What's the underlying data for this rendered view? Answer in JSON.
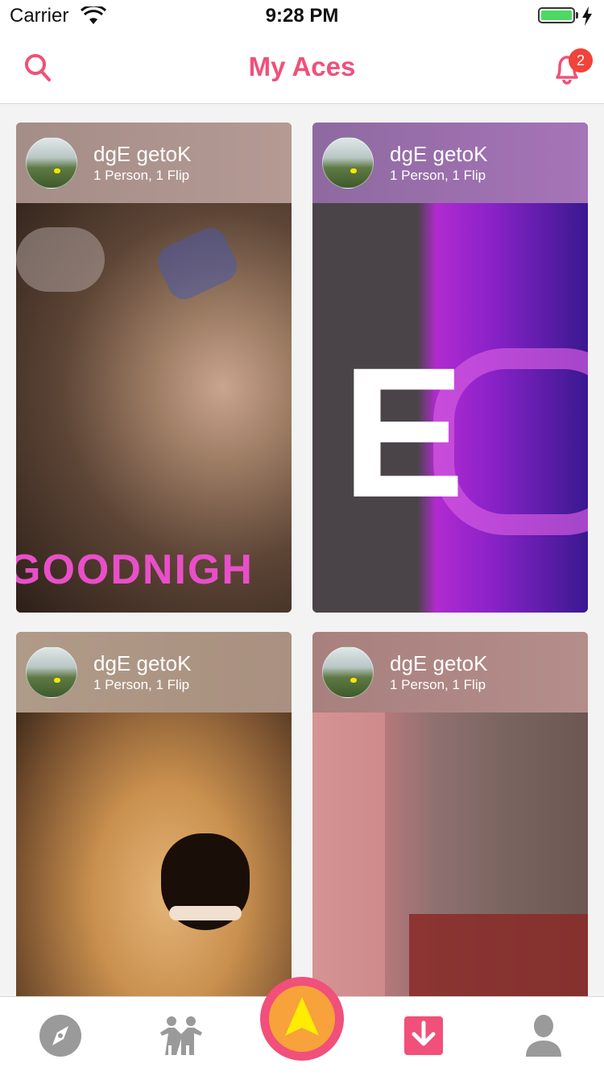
{
  "status_bar": {
    "carrier": "Carrier",
    "time": "9:28 PM",
    "battery_level": 1.0
  },
  "nav": {
    "title": "My Aces",
    "notification_count": "2"
  },
  "feed": {
    "cards": [
      {
        "name": "dgE getoK",
        "meta": "1 Person, 1 Flip",
        "media_text": "GOODNIGH"
      },
      {
        "name": "dgE getoK",
        "meta": "1 Person, 1 Flip",
        "media_text": "E"
      },
      {
        "name": "dgE getoK",
        "meta": "1 Person, 1 Flip",
        "media_text": ""
      },
      {
        "name": "dgE getoK",
        "meta": "1 Person, 1 Flip",
        "media_text": ""
      }
    ]
  },
  "tab_bar": {
    "tabs": [
      "compass-icon",
      "people-icon",
      "ace-icon",
      "download-icon",
      "profile-icon"
    ],
    "active": "download-icon"
  },
  "colors": {
    "accent": "#f0507a",
    "badge": "#f0433a",
    "center_inner": "#f7a23a",
    "center_arrow": "#ffec00"
  }
}
